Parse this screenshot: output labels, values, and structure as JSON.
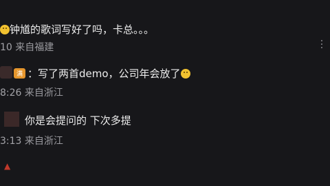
{
  "comments": [
    {
      "text": "钟馗的歌词写好了吗，卡总。。。",
      "meta_num": "10",
      "meta_loc": "来自福建"
    },
    {
      "badge": "满",
      "text": "：写了两首demo，公司年会放了",
      "meta_num": "8:26",
      "meta_loc": "来自浙江"
    },
    {
      "text": "你是会提问的  下次多提",
      "meta_num": "3:13",
      "meta_loc": "来自浙江"
    }
  ],
  "icons": {
    "face_emoji": "smile-emoji-icon",
    "more": "more-vertical-icon",
    "like": "heart-icon"
  },
  "colors": {
    "background": "#17171a",
    "text": "#ededed",
    "meta": "#9a9a9f",
    "badge": "#e6962d"
  }
}
